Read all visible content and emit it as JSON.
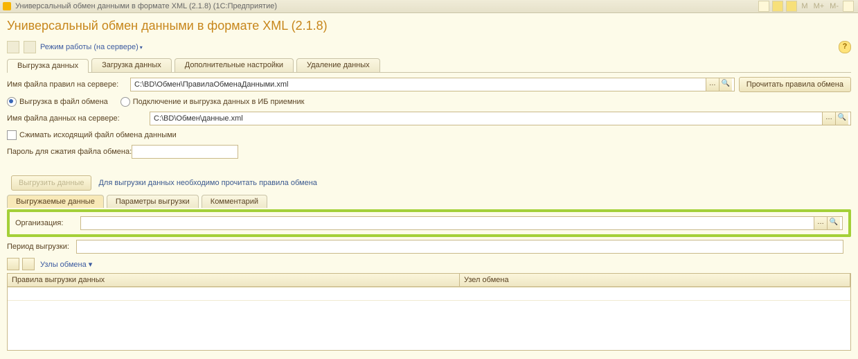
{
  "titlebar": {
    "title": "Универсальный обмен данными в формате XML (2.1.8)  (1С:Предприятие)",
    "m1": "M",
    "m2": "M+",
    "m3": "M-"
  },
  "page_title": "Универсальный обмен данными в формате XML (2.1.8)",
  "mode_label": "Режим работы (на сервере)",
  "tabs": {
    "export": "Выгрузка данных",
    "import": "Загрузка данных",
    "settings": "Дополнительные настройки",
    "delete": "Удаление данных"
  },
  "labels": {
    "rules_file": "Имя файла правил на сервере:",
    "read_rules_btn": "Прочитать правила обмена",
    "radio_file": "Выгрузка в файл обмена",
    "radio_ib": "Подключение и выгрузка данных в ИБ приемник",
    "data_file": "Имя файла данных на сервере:",
    "compress": "Сжимать исходящий файл обмена данными",
    "password": "Пароль для сжатия файла обмена:",
    "export_btn": "Выгрузить данные",
    "export_hint": "Для выгрузки данных необходимо прочитать правила обмена"
  },
  "values": {
    "rules_file": "C:\\BD\\Обмен\\ПравилаОбменаДанными.xml",
    "data_file": "C:\\BD\\Обмен\\данные.xml",
    "password": ""
  },
  "subtabs": {
    "exported": "Выгружаемые данные",
    "params": "Параметры выгрузки",
    "comment": "Комментарий"
  },
  "highlight": {
    "org_label": "Организация:",
    "org_value": ""
  },
  "period_label": "Период выгрузки:",
  "nodes_label": "Узлы обмена",
  "grid": {
    "col1": "Правила выгрузки данных",
    "col2": "Узел обмена"
  },
  "glyphs": {
    "dots": "…",
    "mag": "🔍",
    "drop": "▾"
  }
}
